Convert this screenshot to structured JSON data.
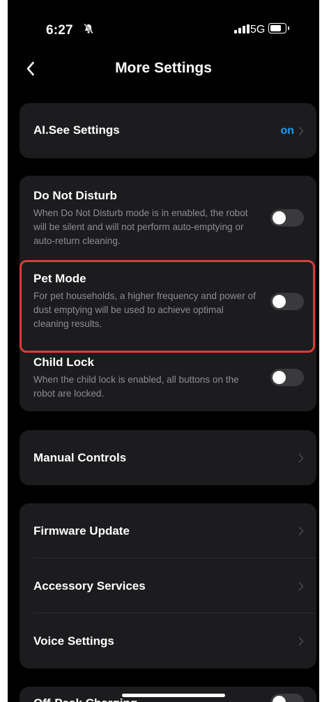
{
  "status_bar": {
    "time": "6:27",
    "network": "5G"
  },
  "header": {
    "title": "More Settings"
  },
  "ai_see": {
    "label": "AI.See Settings",
    "value": "on"
  },
  "toggles": [
    {
      "title": "Do Not Disturb",
      "description": "When Do Not Disturb mode is in enabled, the robot will be silent and will not perform auto-emptying or auto-return cleaning.",
      "enabled": false
    },
    {
      "title": "Pet Mode",
      "description": "For pet households, a higher frequency and power of dust emptying will be used to achieve optimal cleaning results.",
      "enabled": false
    },
    {
      "title": "Child Lock",
      "description": "When the child lock is enabled, all buttons on the robot are locked.",
      "enabled": false
    }
  ],
  "manual_controls": {
    "label": "Manual Controls"
  },
  "device_menu": [
    {
      "label": "Firmware Update"
    },
    {
      "label": "Accessory Services"
    },
    {
      "label": "Voice Settings"
    }
  ],
  "partial_row": {
    "label": "Off-Peak Charging"
  },
  "colors": {
    "background": "#000000",
    "card": "#1c1c1e",
    "accent": "#1a9cf0",
    "highlight": "#e03a3a",
    "secondary_text": "#8e8e93"
  }
}
